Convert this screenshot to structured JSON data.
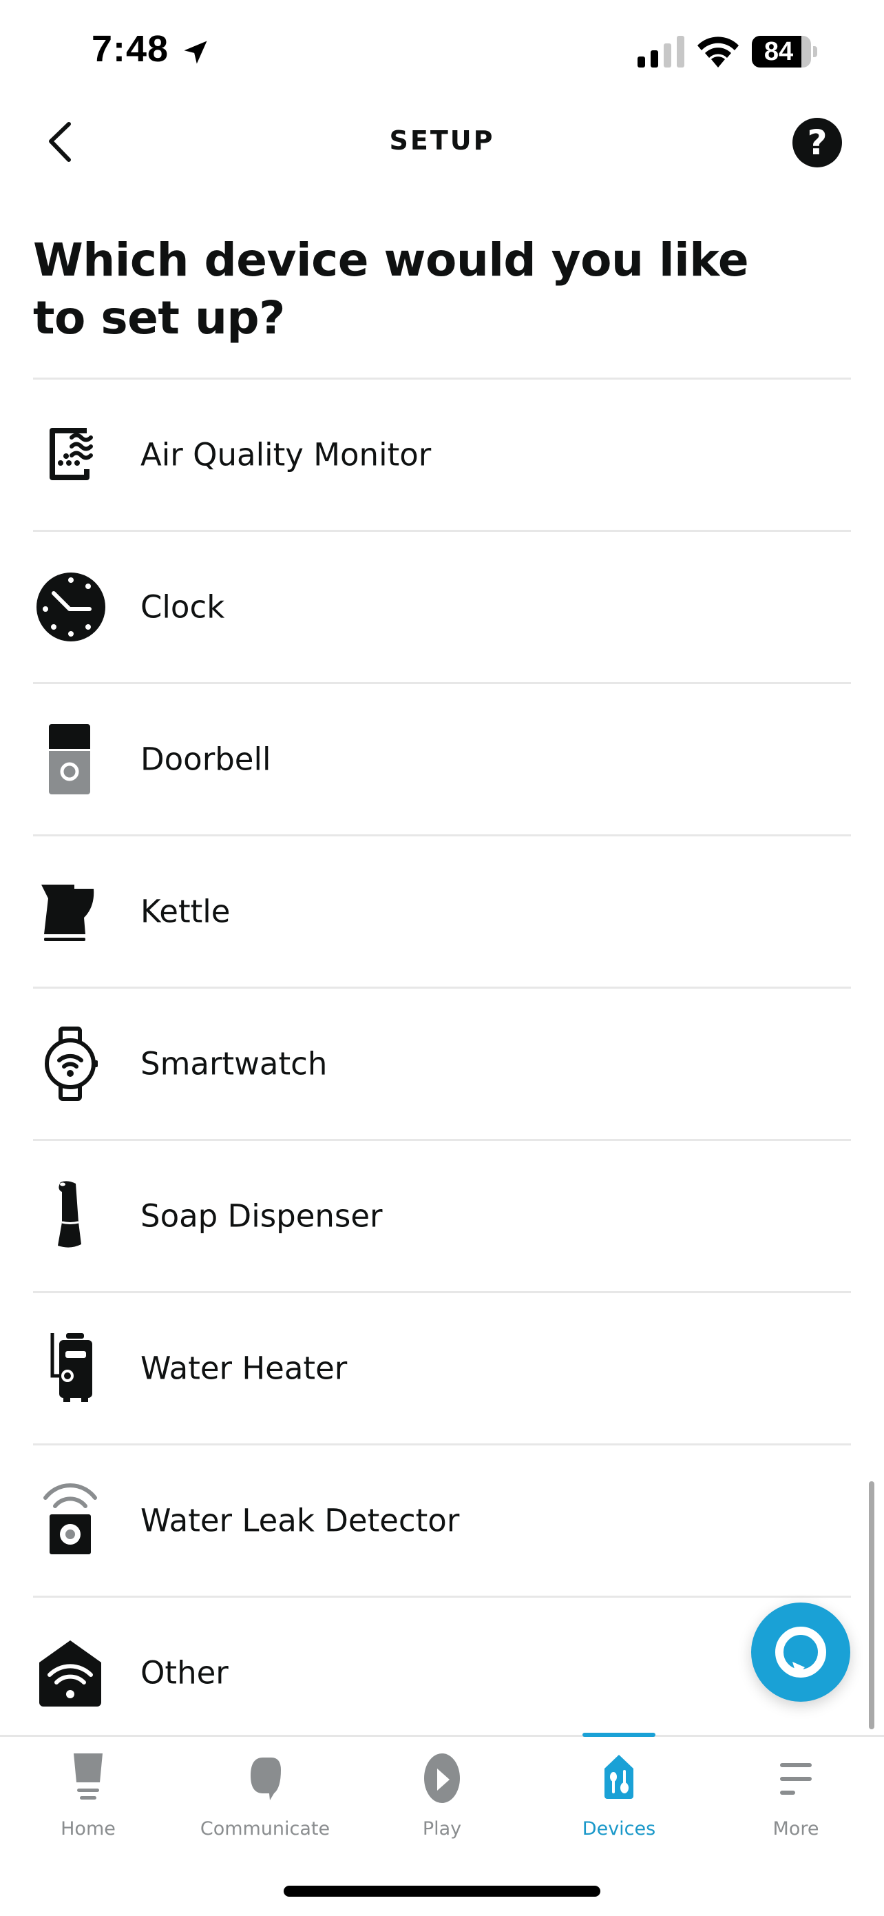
{
  "status_bar": {
    "time": "7:48",
    "battery_percent": "84",
    "battery_level": 0.84,
    "signal_bars_active": 2,
    "signal_bars_total": 4,
    "icons": [
      "location-arrow-icon",
      "cellular-signal-icon",
      "wifi-icon",
      "battery-icon"
    ]
  },
  "nav": {
    "title": "SETUP",
    "back_icon": "chevron-left-icon",
    "help_icon": "help-circle-icon",
    "help_glyph": "?"
  },
  "heading": "Which device would you like to set up?",
  "devices": [
    {
      "label": "Air Quality Monitor",
      "icon": "air-quality-monitor-icon"
    },
    {
      "label": "Clock",
      "icon": "clock-icon"
    },
    {
      "label": "Doorbell",
      "icon": "doorbell-icon"
    },
    {
      "label": "Kettle",
      "icon": "kettle-icon"
    },
    {
      "label": "Smartwatch",
      "icon": "smartwatch-icon"
    },
    {
      "label": "Soap Dispenser",
      "icon": "soap-dispenser-icon"
    },
    {
      "label": "Water Heater",
      "icon": "water-heater-icon"
    },
    {
      "label": "Water Leak Detector",
      "icon": "water-leak-detector-icon"
    },
    {
      "label": "Other",
      "icon": "other-wifi-device-icon"
    }
  ],
  "fab": {
    "icon": "alexa-icon"
  },
  "tabs": [
    {
      "label": "Home",
      "icon": "home-icon",
      "active": false
    },
    {
      "label": "Communicate",
      "icon": "communicate-icon",
      "active": false
    },
    {
      "label": "Play",
      "icon": "play-icon",
      "active": false
    },
    {
      "label": "Devices",
      "icon": "devices-icon",
      "active": true
    },
    {
      "label": "More",
      "icon": "more-icon",
      "active": false
    }
  ],
  "colors": {
    "accent": "#1aa1d6",
    "text": "#0f1111",
    "inactive_tab": "#8a8d8f",
    "divider": "#e7e7e7"
  }
}
